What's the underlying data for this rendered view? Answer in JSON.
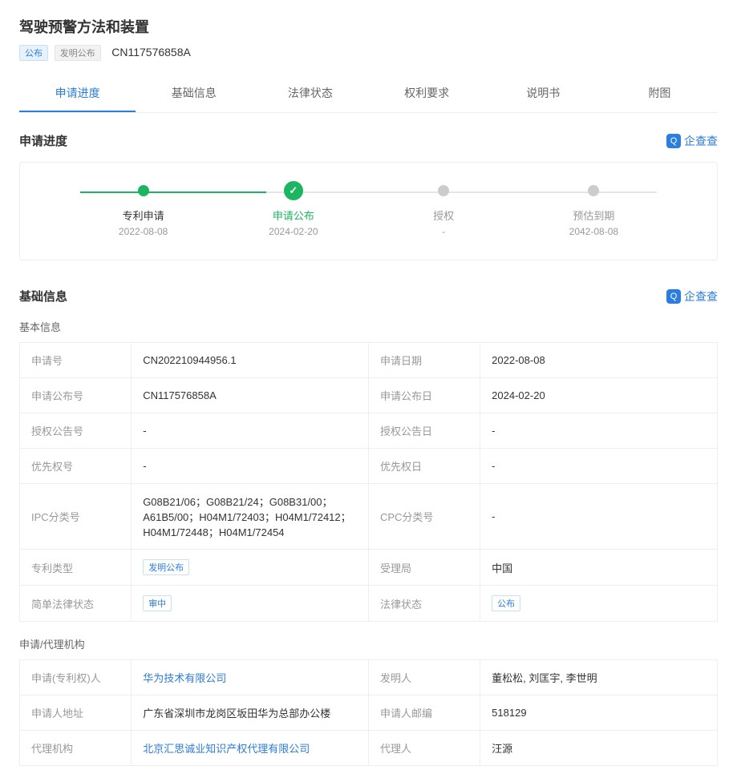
{
  "header": {
    "title": "驾驶预警方法和装置",
    "status_badge": "公布",
    "type_badge": "发明公布",
    "patent_no": "CN117576858A"
  },
  "tabs": [
    "申请进度",
    "基础信息",
    "法律状态",
    "权利要求",
    "说明书",
    "附图"
  ],
  "brand": "企查查",
  "sections": {
    "progress": "申请进度",
    "basic": "基础信息",
    "basic_sub": "基本信息",
    "applicant_sub": "申请/代理机构"
  },
  "timeline": [
    {
      "label": "专利申请",
      "date": "2022-08-08",
      "state": "done"
    },
    {
      "label": "申请公布",
      "date": "2024-02-20",
      "state": "current"
    },
    {
      "label": "授权",
      "date": "-",
      "state": "pending"
    },
    {
      "label": "预估到期",
      "date": "2042-08-08",
      "state": "pending"
    }
  ],
  "basic_rows": [
    [
      {
        "k": "申请号",
        "v": "CN202210944956.1"
      },
      {
        "k": "申请日期",
        "v": "2022-08-08"
      }
    ],
    [
      {
        "k": "申请公布号",
        "v": "CN117576858A"
      },
      {
        "k": "申请公布日",
        "v": "2024-02-20"
      }
    ],
    [
      {
        "k": "授权公告号",
        "v": "-"
      },
      {
        "k": "授权公告日",
        "v": "-"
      }
    ],
    [
      {
        "k": "优先权号",
        "v": "-"
      },
      {
        "k": "优先权日",
        "v": "-"
      }
    ],
    [
      {
        "k": "IPC分类号",
        "v": "G08B21/06；G08B21/24；G08B31/00；A61B5/00；H04M1/72403；H04M1/72412；H04M1/72448；H04M1/72454"
      },
      {
        "k": "CPC分类号",
        "v": "-"
      }
    ],
    [
      {
        "k": "专利类型",
        "v": "发明公布",
        "tag": "blue"
      },
      {
        "k": "受理局",
        "v": "中国"
      }
    ],
    [
      {
        "k": "简单法律状态",
        "v": "审中",
        "tag": "blue"
      },
      {
        "k": "法律状态",
        "v": "公布",
        "tag": "blue"
      }
    ]
  ],
  "applicant_rows": [
    [
      {
        "k": "申请(专利权)人",
        "v": "华为技术有限公司",
        "link": true
      },
      {
        "k": "发明人",
        "v": "董松松, 刘匡宇, 李世明"
      }
    ],
    [
      {
        "k": "申请人地址",
        "v": "广东省深圳市龙岗区坂田华为总部办公楼"
      },
      {
        "k": "申请人邮编",
        "v": "518129"
      }
    ],
    [
      {
        "k": "代理机构",
        "v": "北京汇思诚业知识产权代理有限公司",
        "link": true
      },
      {
        "k": "代理人",
        "v": "汪源"
      }
    ]
  ]
}
